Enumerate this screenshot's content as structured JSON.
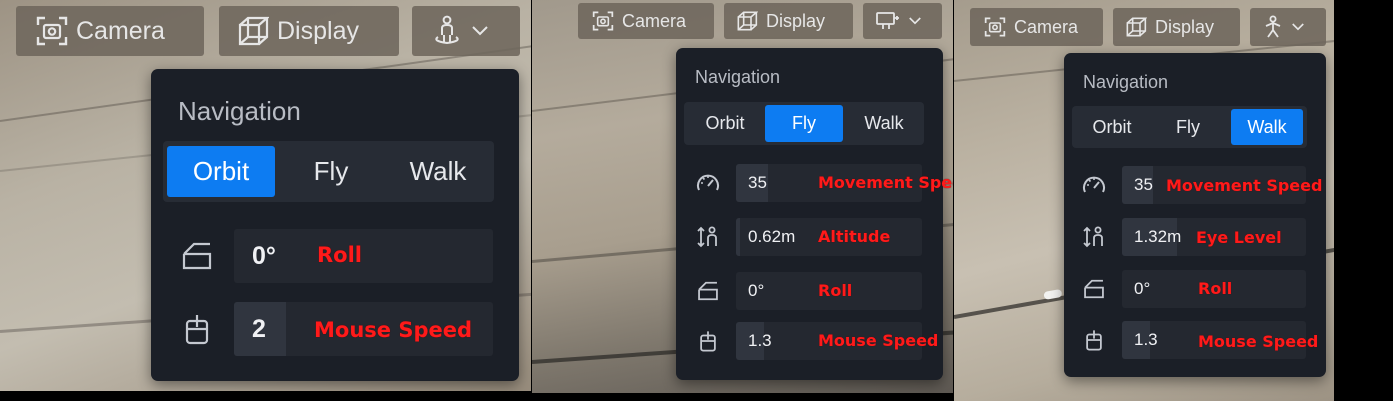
{
  "colors": {
    "accent": "#0d7cf2",
    "panel_bg": "#1b1f27",
    "annotation": "#ff1a1a"
  },
  "views": [
    {
      "toolbar": {
        "camera_label": "Camera",
        "display_label": "Display",
        "nav_icon": "orbit-person-icon"
      },
      "navigation": {
        "title": "Navigation",
        "modes": [
          "Orbit",
          "Fly",
          "Walk"
        ],
        "active_mode": "Orbit",
        "rows": [
          {
            "icon": "roll-icon",
            "value": "0°",
            "annotation": "Roll",
            "level": 0.0
          },
          {
            "icon": "mouse-icon",
            "value": "2",
            "annotation": "Mouse Speed",
            "level": 0.2
          }
        ]
      }
    },
    {
      "toolbar": {
        "camera_label": "Camera",
        "display_label": "Display",
        "nav_icon": "fly-icon"
      },
      "navigation": {
        "title": "Navigation",
        "modes": [
          "Orbit",
          "Fly",
          "Walk"
        ],
        "active_mode": "Fly",
        "rows": [
          {
            "icon": "speedometer-icon",
            "value": "35",
            "annotation": "Movement Speed",
            "level": 0.17
          },
          {
            "icon": "altitude-icon",
            "value": "0.62m",
            "annotation": "Altitude",
            "level": 0.02
          },
          {
            "icon": "roll-icon",
            "value": "0°",
            "annotation": "Roll",
            "level": 0.0
          },
          {
            "icon": "mouse-icon",
            "value": "1.3",
            "annotation": "Mouse Speed",
            "level": 0.15
          }
        ]
      }
    },
    {
      "toolbar": {
        "camera_label": "Camera",
        "display_label": "Display",
        "nav_icon": "walk-person-icon"
      },
      "navigation": {
        "title": "Navigation",
        "modes": [
          "Orbit",
          "Fly",
          "Walk"
        ],
        "active_mode": "Walk",
        "rows": [
          {
            "icon": "speedometer-icon",
            "value": "35",
            "annotation": "Movement Speed",
            "level": 0.17
          },
          {
            "icon": "eye-level-icon",
            "value": "1.32m",
            "annotation": "Eye Level",
            "level": 0.3
          },
          {
            "icon": "roll-icon",
            "value": "0°",
            "annotation": "Roll",
            "level": 0.0
          },
          {
            "icon": "mouse-icon",
            "value": "1.3",
            "annotation": "Mouse Speed",
            "level": 0.15
          }
        ]
      }
    }
  ]
}
